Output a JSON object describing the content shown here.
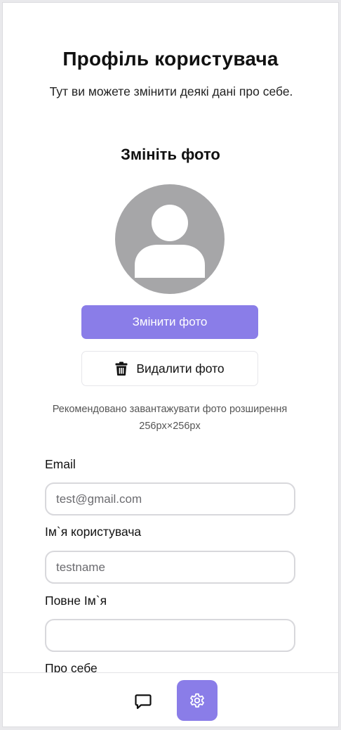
{
  "header": {
    "title": "Профіль користувача",
    "subtitle": "Тут ви можете змінити деякі дані про себе."
  },
  "photo": {
    "section_title": "Змініть фото",
    "avatar_icon": "user-silhouette-icon",
    "change_label": "Змінити фото",
    "delete_label": "Видалити фото",
    "delete_icon": "trash-icon",
    "hint": "Рекомендовано завантажувати фото розширення 256px×256px"
  },
  "form": {
    "email": {
      "label": "Email",
      "value": "",
      "placeholder": "test@gmail.com"
    },
    "username": {
      "label": "Ім`я користувача",
      "value": "",
      "placeholder": "testname"
    },
    "fullname": {
      "label": "Повне Ім`я",
      "value": "",
      "placeholder": ""
    },
    "about": {
      "label": "Про себе"
    }
  },
  "bottom_nav": {
    "items": [
      {
        "icon": "chat-bubble-icon",
        "active": false
      },
      {
        "icon": "gear-icon",
        "active": true
      }
    ]
  },
  "colors": {
    "accent": "#8a7de8",
    "avatar_bg": "#a6a6a8",
    "input_border": "#d8d8dc"
  }
}
